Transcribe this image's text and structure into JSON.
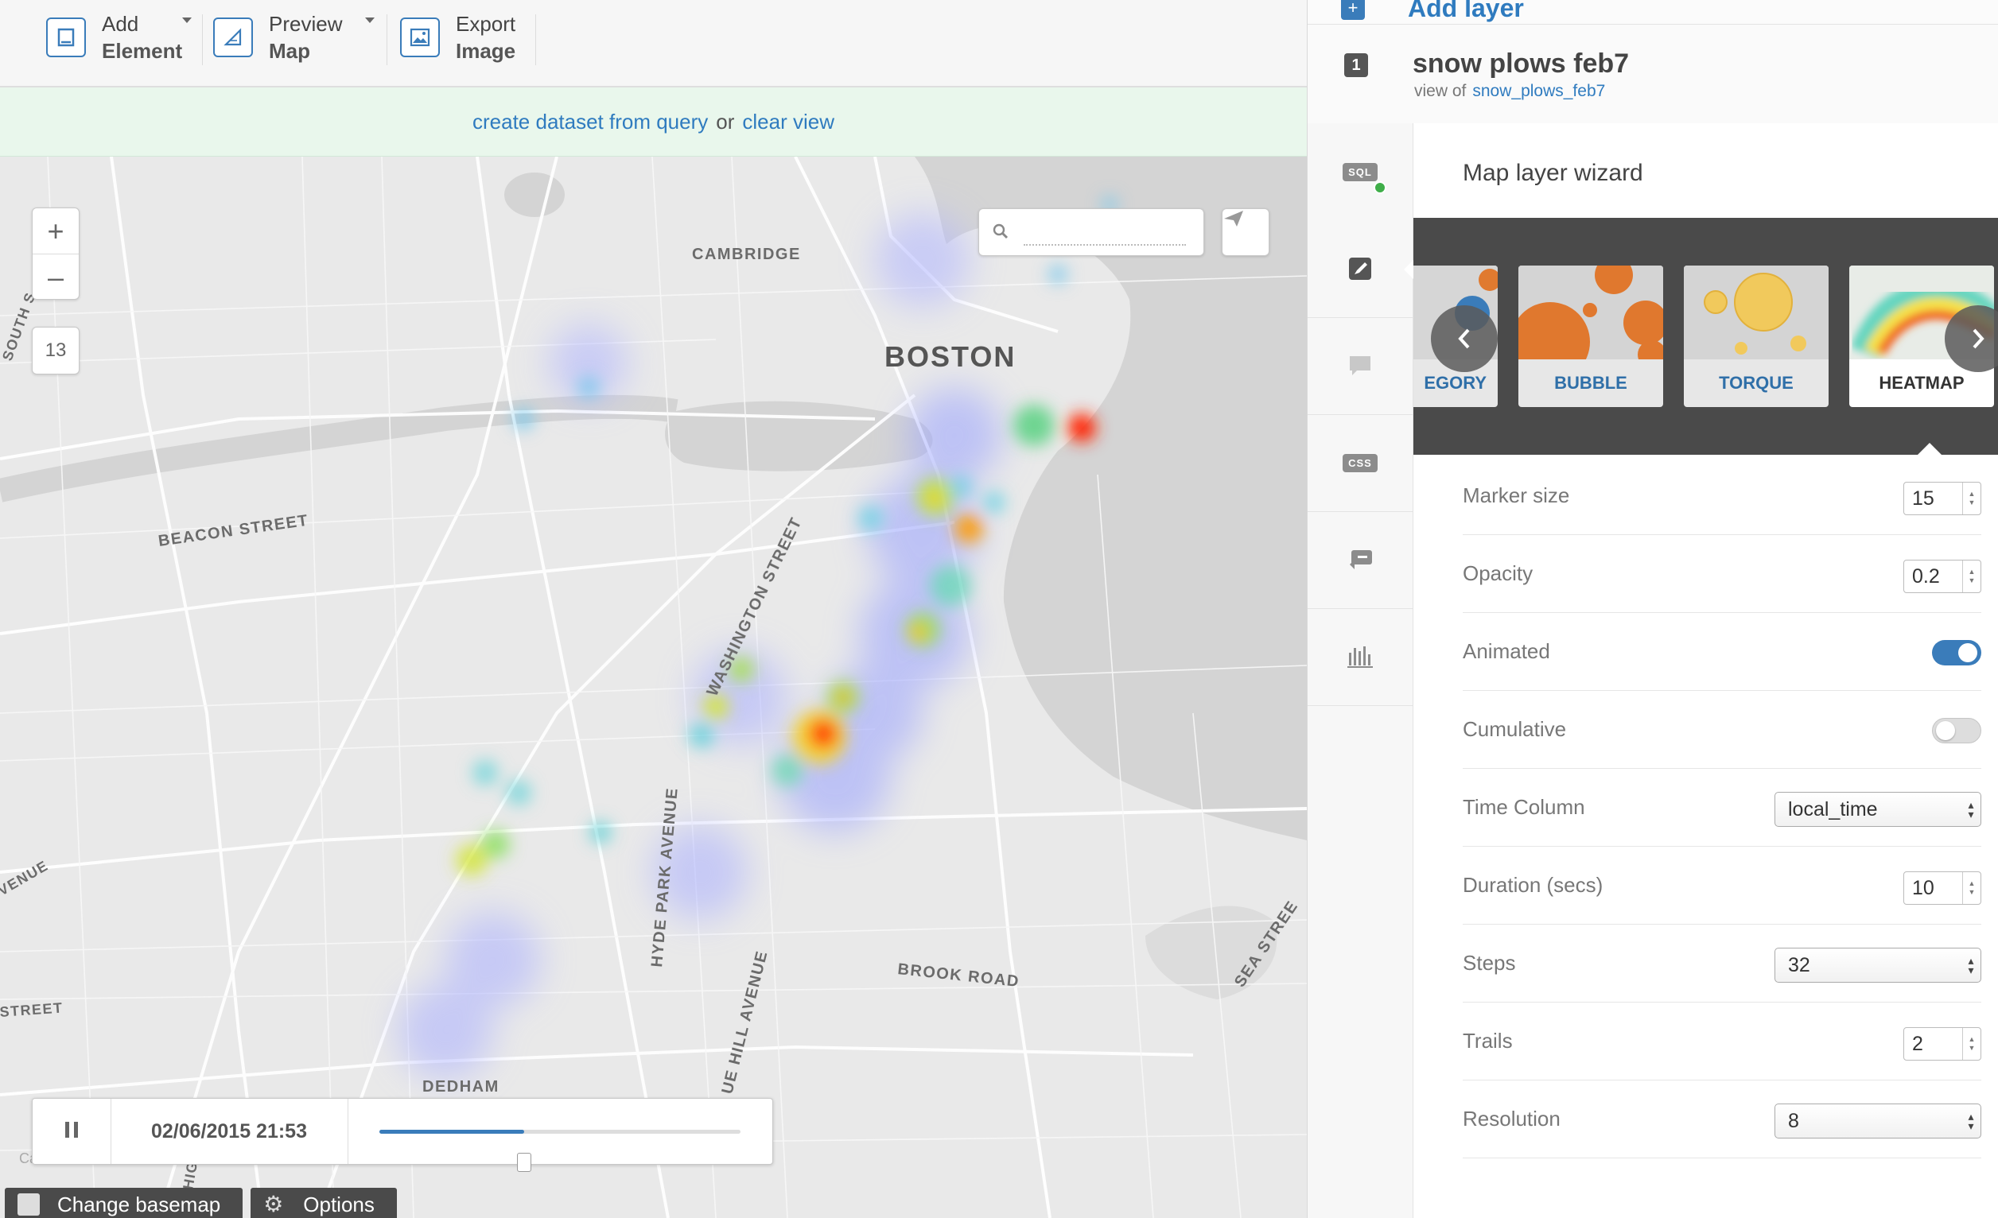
{
  "toolbar": {
    "add_element": {
      "line1": "Add",
      "line2": "Element"
    },
    "preview_map": {
      "line1": "Preview",
      "line2": "Map"
    },
    "export_image": {
      "line1": "Export",
      "line2": "Image"
    }
  },
  "querybar": {
    "create_dataset": "create dataset from query",
    "or": "or",
    "clear_view": "clear view"
  },
  "map": {
    "zoom_in": "+",
    "zoom_out": "–",
    "zoom_level": "13",
    "search_placeholder": "",
    "labels": {
      "cambridge": "CAMBRIDGE",
      "boston": "BOSTON",
      "beacon": "BEACON STREET",
      "washington": "WASHINGTON STREET",
      "hyde_park": "HYDE PARK AVENUE",
      "brook": "BROOK ROAD",
      "dedham": "DEDHAM",
      "blue_hill": "UE HILL AVENUE",
      "sea": "SEA STREE",
      "south": "SOUTH S",
      "venue": "VENUE",
      "street_left": "STREET",
      "hig": "HIG"
    },
    "attribution": "CartoDB",
    "basemap_button": "Change basemap",
    "options_button": "Options",
    "timebar": {
      "date": "02/06/2015 21:53",
      "progress": 0.4
    }
  },
  "panel": {
    "add_layer": "Add layer",
    "layer": {
      "number": "1",
      "name": "snow plows feb7",
      "view_of_prefix": "view of",
      "source_table": "snow_plows_feb7"
    },
    "side_tabs": [
      "sql",
      "wizard",
      "infowindow",
      "css",
      "legends",
      "filters"
    ],
    "sql_label": "SQL",
    "css_label": "CSS",
    "wizard": {
      "title": "Map layer wizard",
      "cards": [
        "EGORY",
        "BUBBLE",
        "TORQUE",
        "HEATMAP"
      ],
      "selected_card": "HEATMAP",
      "properties": {
        "marker_size": {
          "label": "Marker size",
          "value": "15"
        },
        "opacity": {
          "label": "Opacity",
          "value": "0.2"
        },
        "animated": {
          "label": "Animated",
          "value": true
        },
        "cumulative": {
          "label": "Cumulative",
          "value": false
        },
        "time_column": {
          "label": "Time Column",
          "value": "local_time"
        },
        "duration": {
          "label": "Duration (secs)",
          "value": "10"
        },
        "steps": {
          "label": "Steps",
          "value": "32"
        },
        "trails": {
          "label": "Trails",
          "value": "2"
        },
        "resolution": {
          "label": "Resolution",
          "value": "8"
        }
      }
    }
  },
  "colors": {
    "accent": "#3a7cba",
    "link": "#2f7bbf",
    "querybar_bg": "#e9f7ec",
    "carousel_bg": "#4a4a4a"
  }
}
